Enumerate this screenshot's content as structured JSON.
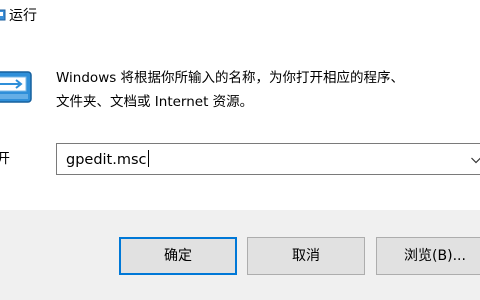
{
  "window": {
    "title": "运行"
  },
  "dialog": {
    "description_line1": "Windows 将根据你所输入的名称，为你打开相应的程序、",
    "description_line2": "文件夹、文档或 Internet 资源。",
    "open_label": "开",
    "open_value": "gpedit.msc"
  },
  "buttons": {
    "ok": "确定",
    "cancel": "取消",
    "browse": "浏览(B)..."
  },
  "colors": {
    "accent": "#0078d7",
    "footer_bg": "#f0f0f0",
    "button_bg": "#e1e1e1"
  },
  "icons": {
    "title": "run-icon",
    "dialog": "run-app-icon",
    "dropdown": "chevron-down-icon"
  }
}
